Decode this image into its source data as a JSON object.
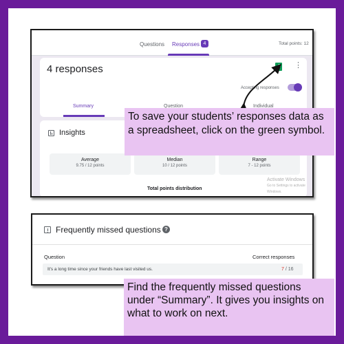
{
  "tabs": {
    "questions": "Questions",
    "responses": "Responses",
    "responses_badge": "4",
    "total_points": "Total points: 12"
  },
  "summary_card": {
    "count_label": "4 responses",
    "accepting_label": "Accepting responses",
    "sub_tabs": [
      "Summary",
      "Question",
      "Individual"
    ]
  },
  "insights": {
    "title": "Insights",
    "stats": [
      {
        "label": "Average",
        "value": "9.75 / 12 points"
      },
      {
        "label": "Median",
        "value": "10 / 12 points"
      },
      {
        "label": "Range",
        "value": "7 - 12 points"
      }
    ],
    "distribution_title": "Total points distribution",
    "watermark_line1": "Activate Windows",
    "watermark_line2": "Go to Settings to activate Windows."
  },
  "callout_top": {
    "text": "To save your students’ responses data as a spreadsheet, click on the green symbol."
  },
  "missed": {
    "title": "Frequently missed questions",
    "col_question": "Question",
    "col_correct": "Correct responses",
    "row_text": "It's a long time since your friends have last visited us.",
    "row_correct": "7",
    "row_total": "/ 16"
  },
  "callout_bottom": {
    "text": "Find the frequently missed questions under “Summary”. It gives you insights on what to work on next."
  },
  "colors": {
    "frame": "#6a1b9a",
    "accent": "#673ab7",
    "sheets_green": "#0f9d58",
    "callout_bg": "#e9c4f2",
    "error_red": "#d93025"
  }
}
